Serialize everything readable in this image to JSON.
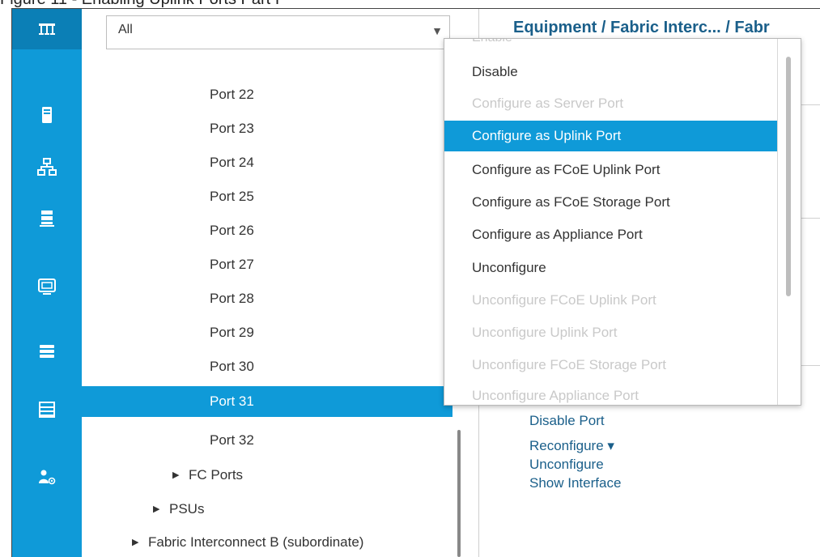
{
  "caption": "Figure 11 - Enabling Uplink Ports Part I",
  "rail": {
    "items": [
      {
        "icon": "network-icon",
        "active": true
      },
      {
        "icon": "server-icon"
      },
      {
        "icon": "lan-icon"
      },
      {
        "icon": "storage-icon"
      },
      {
        "icon": "vm-icon"
      },
      {
        "icon": "chassis-icon"
      },
      {
        "icon": "list-icon"
      },
      {
        "icon": "admin-icon"
      }
    ]
  },
  "tree": {
    "filter_value": "All",
    "items": [
      {
        "label": "Port 22"
      },
      {
        "label": "Port 23"
      },
      {
        "label": "Port 24"
      },
      {
        "label": "Port 25"
      },
      {
        "label": "Port 26"
      },
      {
        "label": "Port 27"
      },
      {
        "label": "Port 28"
      },
      {
        "label": "Port 29"
      },
      {
        "label": "Port 30"
      },
      {
        "label": "Port 31",
        "selected": true
      },
      {
        "label": "Port 32"
      },
      {
        "label": "FC Ports",
        "expander": true
      },
      {
        "label": "PSUs",
        "expander": true
      },
      {
        "label": "Fabric Interconnect B (subordinate)",
        "expander": true
      }
    ]
  },
  "content": {
    "breadcrumb": "Equipment / Fabric Interc... / Fabr",
    "actions": [
      "Disable Port",
      "Reconfigure ▾",
      "Unconfigure",
      "Show Interface"
    ]
  },
  "dropdown": {
    "partial_label": "Enable",
    "items": [
      {
        "label": "Disable",
        "state": "enabled"
      },
      {
        "label": "Configure as Server Port",
        "state": "disabled"
      },
      {
        "label": "Configure as Uplink Port",
        "state": "highlighted"
      },
      {
        "label": "Configure as FCoE Uplink Port",
        "state": "enabled"
      },
      {
        "label": "Configure as FCoE Storage Port",
        "state": "enabled"
      },
      {
        "label": "Configure as Appliance Port",
        "state": "enabled"
      },
      {
        "label": "Unconfigure",
        "state": "enabled"
      },
      {
        "label": "Unconfigure FCoE Uplink Port",
        "state": "disabled"
      },
      {
        "label": "Unconfigure Uplink Port",
        "state": "disabled"
      },
      {
        "label": "Unconfigure FCoE Storage Port",
        "state": "disabled"
      },
      {
        "label": "Unconfigure Appliance Port",
        "state": "disabled"
      }
    ]
  },
  "colors": {
    "accent": "#0f9ad8",
    "rail_active": "#0b7fb6",
    "link": "#1a5f8a",
    "disabled_text": "#c9c9c9"
  }
}
